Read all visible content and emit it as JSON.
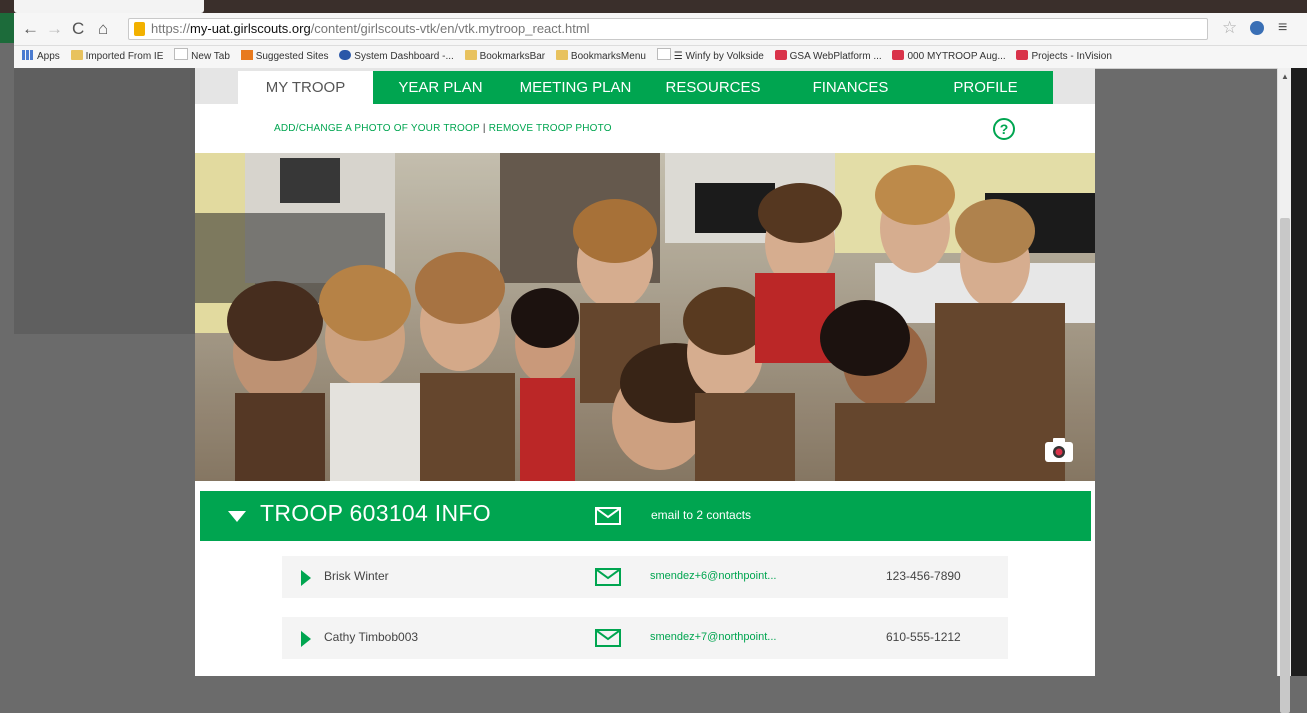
{
  "browser": {
    "tab_title": "",
    "url_scheme": "https://",
    "url_host": "my-uat.girlscouts.org",
    "url_path": "/content/girlscouts-vtk/en/vtk.mytroop_react.html",
    "bookmarks": [
      {
        "label": "Apps",
        "icon": "apps-grid-icon"
      },
      {
        "label": "Imported From IE",
        "icon": "folder-icon"
      },
      {
        "label": "New Tab",
        "icon": "page-icon"
      },
      {
        "label": "Suggested Sites",
        "icon": "suggested-sites-icon"
      },
      {
        "label": "System Dashboard -...",
        "icon": "dashboard-icon"
      },
      {
        "label": "BookmarksBar",
        "icon": "folder-icon"
      },
      {
        "label": "BookmarksMenu",
        "icon": "folder-icon"
      },
      {
        "label": "☰ Winfy by Volkside",
        "icon": "page-icon"
      },
      {
        "label": "GSA WebPlatform ...",
        "icon": "invision-icon"
      },
      {
        "label": "000 MYTROOP Aug...",
        "icon": "invision-icon"
      },
      {
        "label": "Projects - InVision",
        "icon": "invision-icon"
      }
    ]
  },
  "nav": {
    "items": [
      "MY TROOP",
      "YEAR PLAN",
      "MEETING PLAN",
      "RESOURCES",
      "FINANCES",
      "PROFILE"
    ],
    "active": "MY TROOP"
  },
  "photo_actions": {
    "add": "ADD/CHANGE A PHOTO OF YOUR TROOP",
    "separator": "|",
    "remove": "REMOVE TROOP PHOTO"
  },
  "help_icon": "?",
  "troop": {
    "title": "TROOP 603104 INFO",
    "email_label": "email to 2 contacts",
    "contacts": [
      {
        "name": "Brisk Winter",
        "email": "smendez+6@northpoint...",
        "phone": "123-456-7890"
      },
      {
        "name": "Cathy Timbob003",
        "email": "smendez+7@northpoint...",
        "phone": "610-555-1212"
      }
    ]
  },
  "colors": {
    "brand_green": "#00a550",
    "nav_inactive_bg": "#e5e5e5"
  }
}
